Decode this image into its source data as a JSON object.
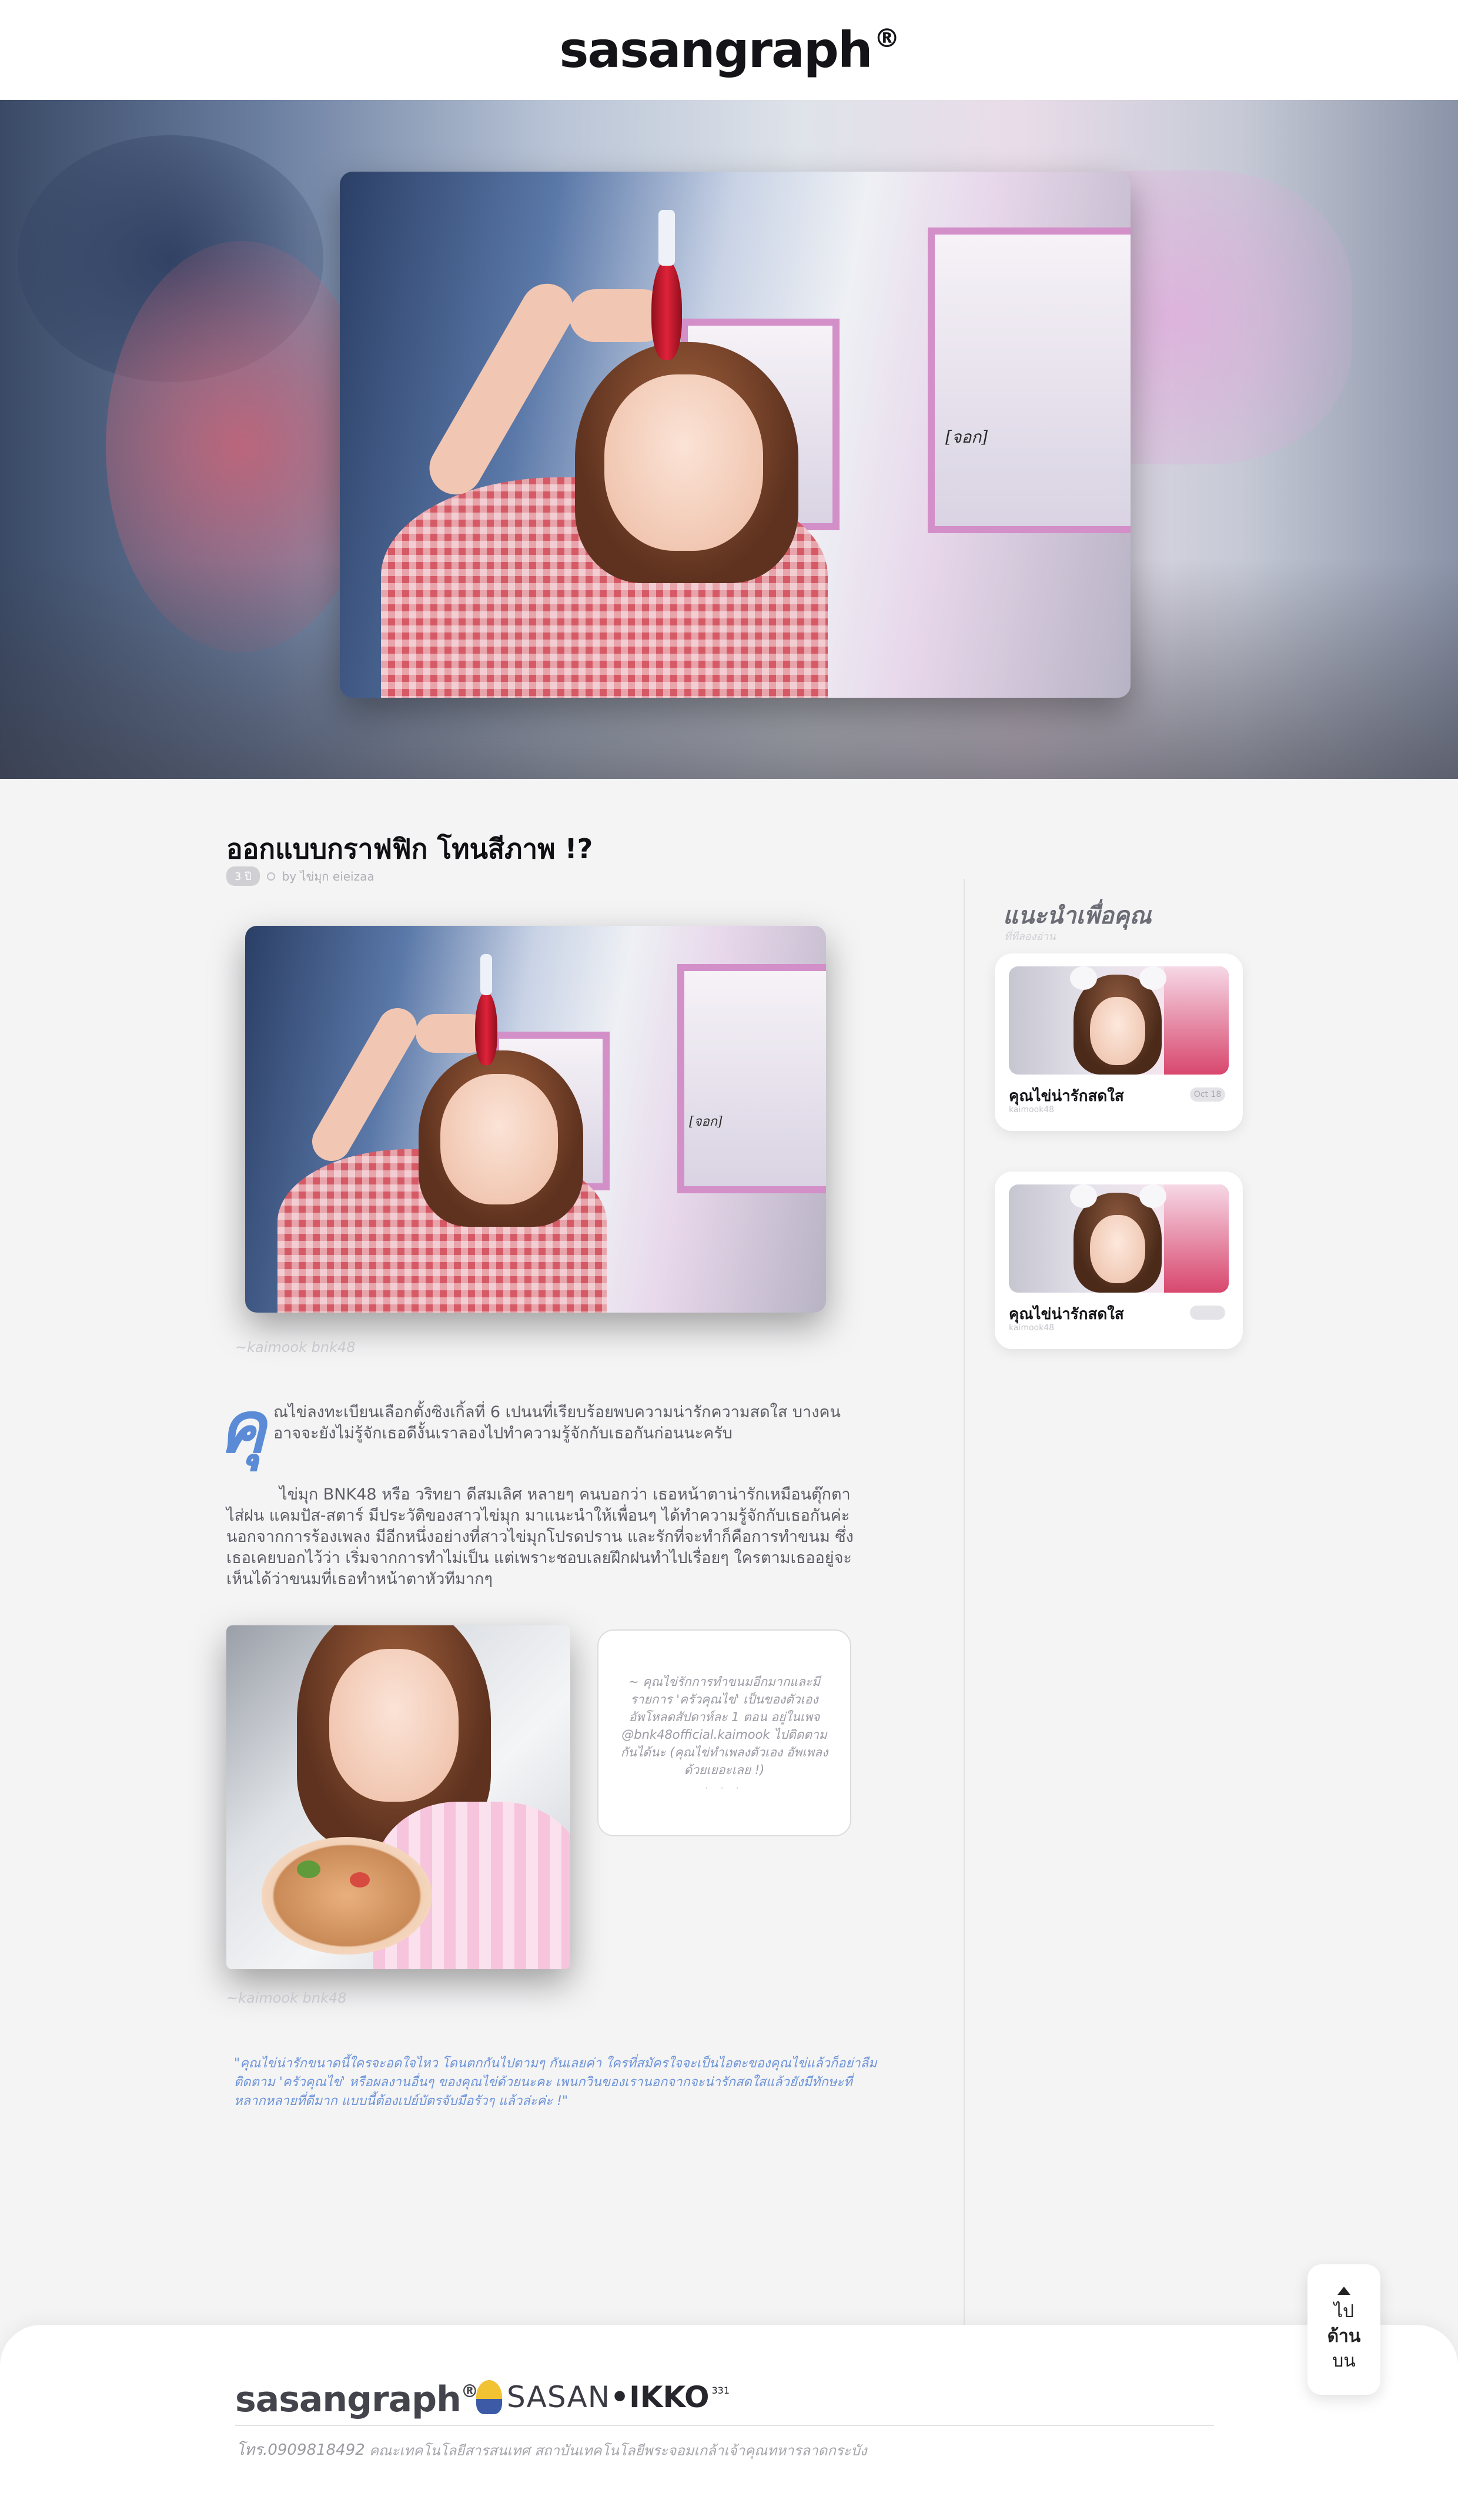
{
  "header": {
    "brand": "sasangraph",
    "brand_mark": "®"
  },
  "hero": {
    "signature": "[จอก]"
  },
  "article": {
    "title": "ออกแบบกราฟฟิก โทนสีภาพ !?",
    "tag": "3 ปี",
    "author": "by ไข่มุก eieizaa",
    "photo1_signature": "[จอก]",
    "photo1_caption": "~kaimook bnk48",
    "dropcap": "คุ",
    "intro": "ณไข่ลงทะเบียนเลือกตั้งซิงเกิ้ลที่ 6 เปนนที่เรียบร้อยพบความน่ารักความสดใส บางคนอาจจะยังไม่รู้จักเธอดีงั้นเราลองไปทำความรู้จักกับเธอกันก่อนนะครับ",
    "body": "ไข่มุก BNK48 หรือ วริทยา ดีสมเลิศ หลายๆ คนบอกว่า เธอหน้าตาน่ารักเหมือนตุ๊กตาไส่ฝน แคมปัส-สตาร์ มีประวัติของสาวไข่มุก มาแนะนำให้เพื่อนๆ ได้ทำความรู้จักกับเธอกันค่ะ นอกจากการร้องเพลง มีอีกหนึ่งอย่างที่สาวไข่มุกโปรดปราน และรักที่จะทำก็คือการทำขนม ซึ่งเธอเคยบอกไว้ว่า เริ่มจากการทำไม่เป็น แต่เพราะชอบเลยฝึกฝนทำไปเรื่อยๆ ใครตามเธออยู่จะเห็นได้ว่าขนมที่เธอทำหน้าตาหัวทีมากๆ",
    "quote": "~ คุณไข่รักการทำขนมอีกมากและมีรายการ 'ครัวคุณไข่' เป็นของตัวเอง อัพโหลดสัปดาห์ละ 1 ตอน อยู่ในเพจ @bnk48official.kaimook ไปติดตามกันได้นะ (คุณไข่ทำเพลงตัวเอง อัพเพลงด้วยเยอะเลย !)",
    "quote_dots": "· · ·",
    "photo2_caption": "~kaimook bnk48",
    "closing": "\"คุณไข่น่ารักขนาดนี้ใครจะอดใจไหว โดนตกกันไปตามๆ กันเลยค่า ใครที่สมัครใจจะเป็นไอตะของคุณไข่แล้วก็อย่าลืมติดตาม 'ครัวคุณไข่' หรือผลงานอื่นๆ ของคุณไข่ด้วยนะคะ เพนกวินของเรานอกจากจะน่ารักสดใสแล้วยังมีทักษะที่หลากหลายที่ดีมาก แบบนี้ต้องเปย์บัตรจับมือรัวๆ แล้วล่ะค่ะ !\""
  },
  "sidebar": {
    "title": "แนะนำเพื่อคุณ",
    "subtitle": "ที่ทีลองอ่าน",
    "cards": [
      {
        "title": "คุณไข่น่ารักสดใส",
        "sub": "kaimook48",
        "badge": "Oct 18"
      },
      {
        "title": "คุณไข่น่ารักสดใส",
        "sub": "kaimook48",
        "badge": ""
      }
    ]
  },
  "back_to_top": {
    "line1": "ไป",
    "line2": "ด้าน",
    "line3": "บน"
  },
  "footer": {
    "brand": "sasangraph",
    "brand_mark": "®",
    "partner_a": "SASAN",
    "partner_b": "•IKKO",
    "partner_c": "331",
    "phone": "โทร.0909818492",
    "address": "คณะเทคโนโลยีสารสนเทศ สถาบันเทคโนโลยีพระจอมเกล้าเจ้าคุณทหารลาดกระบัง"
  }
}
